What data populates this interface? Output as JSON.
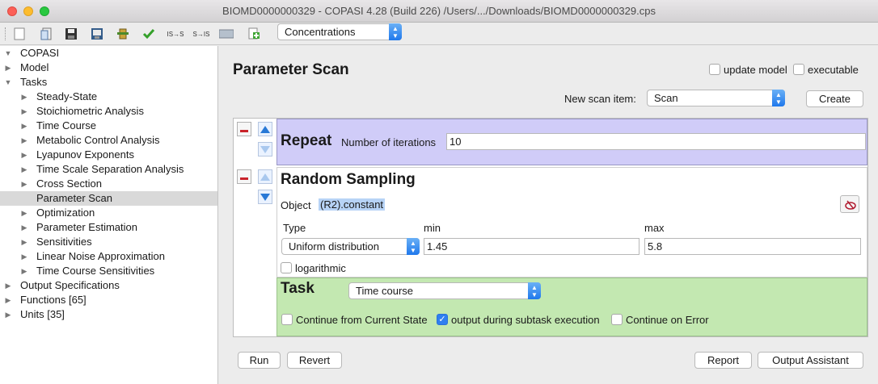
{
  "window": {
    "title": "BIOMD0000000329 - COPASI 4.28 (Build 226) /Users/.../Downloads/BIOMD0000000329.cps"
  },
  "toolbar": {
    "icons": [
      "new-icon",
      "open-icon",
      "save-icon",
      "export-icon",
      "plugin-icon",
      "check-icon",
      "is-to-s-icon",
      "s-to-is-icon",
      "sbml-icon",
      "add-icon"
    ],
    "is_s_label": "IS→S",
    "s_is_label": "S→IS",
    "view_select": "Concentrations"
  },
  "tree": {
    "root": "COPASI",
    "items": [
      {
        "label": "Model",
        "level": 1,
        "expanded": false
      },
      {
        "label": "Tasks",
        "level": 1,
        "expanded": true
      },
      {
        "label": "Steady-State",
        "level": 2,
        "expanded": false
      },
      {
        "label": "Stoichiometric Analysis",
        "level": 2,
        "expanded": false
      },
      {
        "label": "Time Course",
        "level": 2,
        "expanded": false
      },
      {
        "label": "Metabolic Control Analysis",
        "level": 2,
        "expanded": false
      },
      {
        "label": "Lyapunov Exponents",
        "level": 2,
        "expanded": false
      },
      {
        "label": "Time Scale Separation Analysis",
        "level": 2,
        "expanded": false
      },
      {
        "label": "Cross Section",
        "level": 2,
        "expanded": false
      },
      {
        "label": "Parameter Scan",
        "level": 2,
        "selected": true
      },
      {
        "label": "Optimization",
        "level": 2,
        "expanded": false
      },
      {
        "label": "Parameter Estimation",
        "level": 2,
        "expanded": false
      },
      {
        "label": "Sensitivities",
        "level": 2,
        "expanded": false
      },
      {
        "label": "Linear Noise Approximation",
        "level": 2,
        "expanded": false
      },
      {
        "label": "Time Course Sensitivities",
        "level": 2,
        "expanded": false
      },
      {
        "label": "Output Specifications",
        "level": 1,
        "expanded": false
      },
      {
        "label": "Functions [65]",
        "level": 1,
        "expanded": false
      },
      {
        "label": "Units [35]",
        "level": 1,
        "expanded": false
      }
    ]
  },
  "scan": {
    "title": "Parameter Scan",
    "update_model_label": "update model",
    "update_model_checked": false,
    "executable_label": "executable",
    "executable_checked": false,
    "new_item_label": "New scan item:",
    "new_item_value": "Scan",
    "create_label": "Create",
    "repeat": {
      "title": "Repeat",
      "iterations_label": "Number of iterations",
      "iterations_value": "10"
    },
    "random": {
      "title": "Random Sampling",
      "object_label": "Object",
      "object_value": "(R2).constant",
      "type_label": "Type",
      "min_label": "min",
      "max_label": "max",
      "type_value": "Uniform distribution",
      "min_value": "1.45",
      "max_value": "5.8",
      "log_label": "logarithmic",
      "log_checked": false
    },
    "task": {
      "title": "Task",
      "task_value": "Time course",
      "continue_label": "Continue from Current State",
      "continue_checked": false,
      "output_label": "output during subtask execution",
      "output_checked": true,
      "error_label": "Continue on Error",
      "error_checked": false
    },
    "buttons": {
      "run": "Run",
      "revert": "Revert",
      "report": "Report",
      "output_assistant": "Output Assistant"
    }
  },
  "colors": {
    "repeat_bg": "#d0ccf8",
    "task_bg": "#c3e8b1",
    "accent": "#2f7ff0"
  }
}
